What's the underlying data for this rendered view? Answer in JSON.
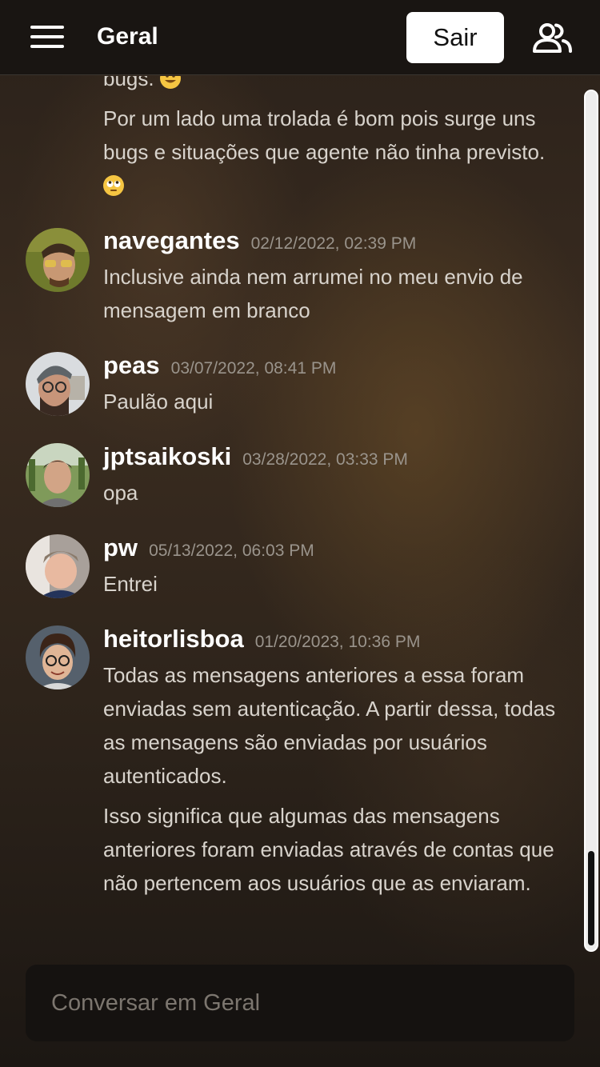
{
  "header": {
    "channel_title": "Geral",
    "logout_label": "Sair"
  },
  "messages": {
    "partial_first_line": "bugs.",
    "continuation_text": "Por um lado uma trolada é bom pois surge uns bugs e situações que agente não tinha previsto.",
    "items": [
      {
        "user": "navegantes",
        "time": "02/12/2022, 02:39 PM",
        "paragraphs": [
          "Inclusive ainda nem arrumei no meu envio de mensagem em branco"
        ]
      },
      {
        "user": "peas",
        "time": "03/07/2022, 08:41 PM",
        "paragraphs": [
          "Paulão aqui"
        ]
      },
      {
        "user": "jptsaikoski",
        "time": "03/28/2022, 03:33 PM",
        "paragraphs": [
          "opa"
        ]
      },
      {
        "user": "pw",
        "time": "05/13/2022, 06:03 PM",
        "paragraphs": [
          "Entrei"
        ]
      },
      {
        "user": "heitorlisboa",
        "time": "01/20/2023, 10:36 PM",
        "paragraphs": [
          "Todas as mensagens anteriores a essa foram enviadas sem autenticação. A partir dessa, todas as mensagens são enviadas por usuários autenticados.",
          "Isso significa que algumas das mensagens anteriores foram enviadas através de contas que não pertencem aos usuários que as enviaram."
        ]
      }
    ]
  },
  "composer": {
    "placeholder": "Conversar em Geral"
  },
  "icons": {
    "menu": "hamburger-menu-icon",
    "users": "users-icon",
    "emoji_grin": "grinning-emoji-icon",
    "emoji_eyeroll": "eye-roll-emoji-icon"
  },
  "colors": {
    "header_bg": "#191512",
    "button_bg": "#ffffff",
    "username": "#ffffff",
    "message_text": "#d8d3cc",
    "timestamp": "#9a948c",
    "composer_bg": "#151210"
  }
}
